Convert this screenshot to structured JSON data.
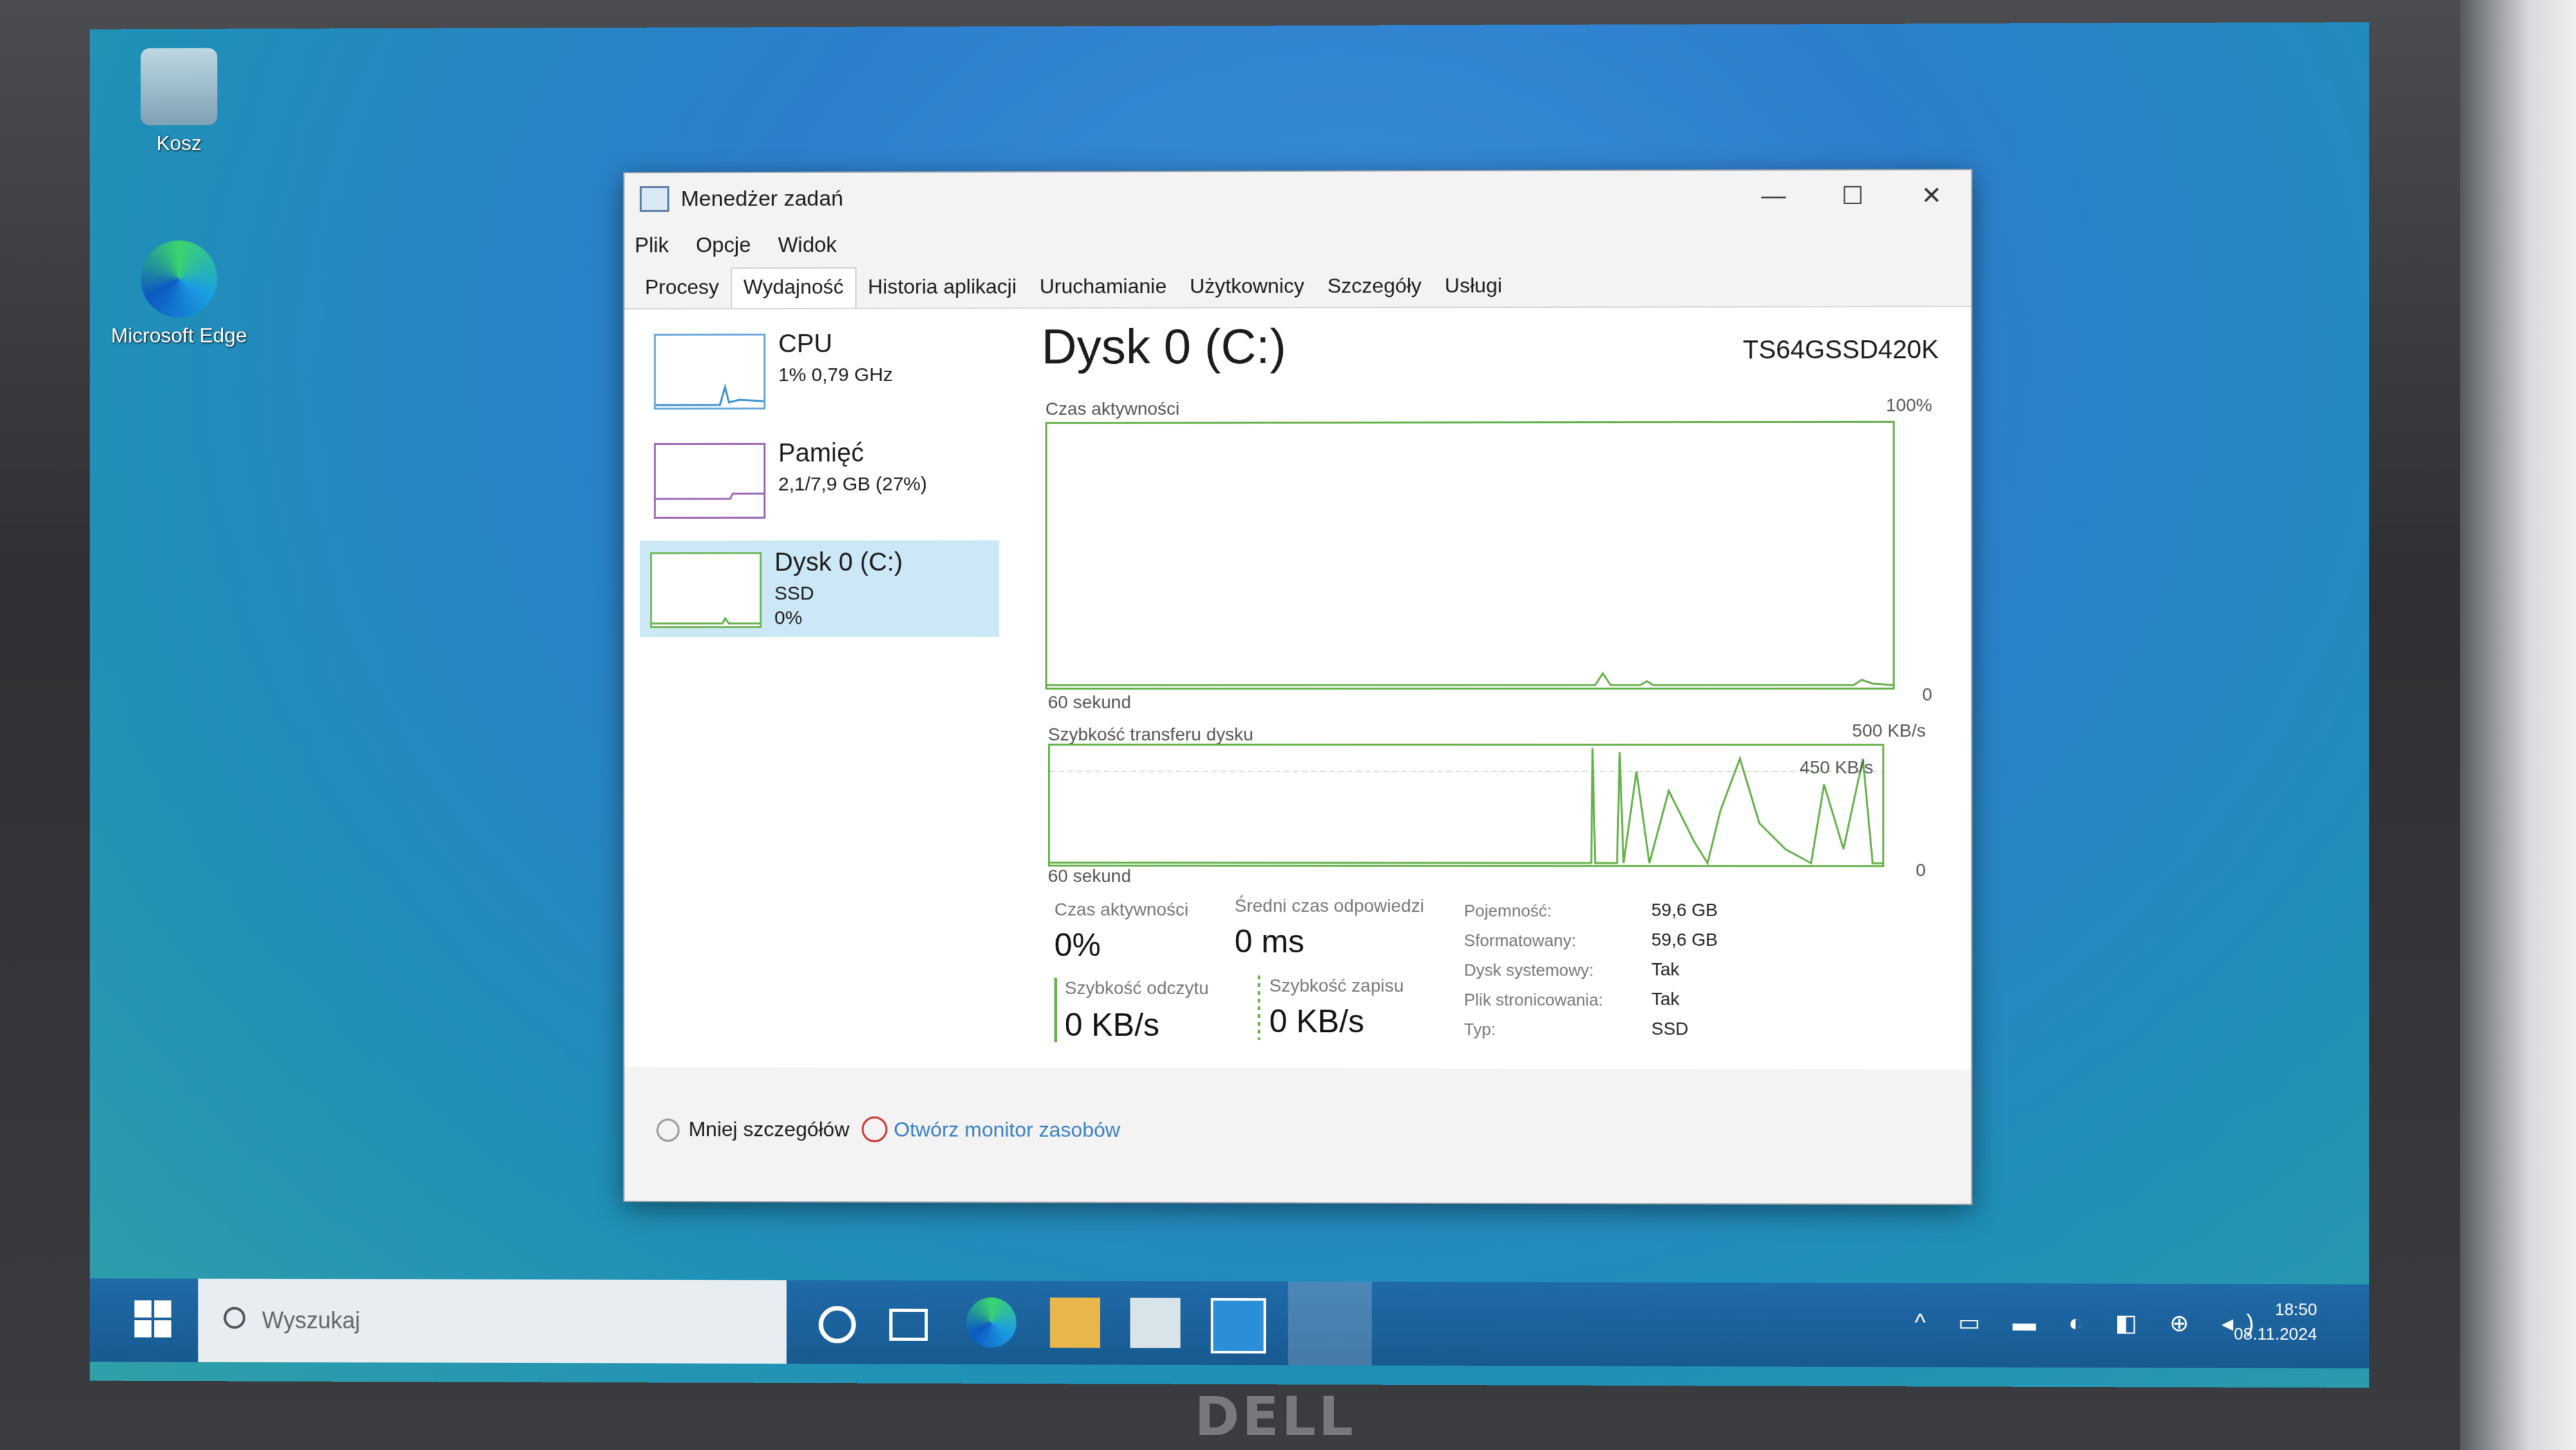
{
  "desktop": {
    "icons": [
      {
        "label": "Kosz"
      },
      {
        "label": "Microsoft Edge"
      }
    ]
  },
  "window": {
    "title": "Menedżer zadań",
    "menu": [
      "Plik",
      "Opcje",
      "Widok"
    ],
    "tabs": [
      "Procesy",
      "Wydajność",
      "Historia aplikacji",
      "Uruchamianie",
      "Użytkownicy",
      "Szczegóły",
      "Usługi"
    ],
    "active_tab": "Wydajność"
  },
  "sidebar": {
    "items": [
      {
        "title": "CPU",
        "sub": "1% 0,79 GHz",
        "sub2": ""
      },
      {
        "title": "Pamięć",
        "sub": "2,1/7,9 GB (27%)",
        "sub2": ""
      },
      {
        "title": "Dysk 0 (C:)",
        "sub": "SSD",
        "sub2": "0%"
      }
    ]
  },
  "disk": {
    "title": "Dysk 0 (C:)",
    "model": "TS64GSSD420K",
    "active_time_label": "Czas aktywności",
    "active_time_max": "100%",
    "sixty_sec": "60 sekund",
    "zero": "0",
    "transfer_label": "Szybkość transferu dysku",
    "transfer_max": "500 KB/s",
    "transfer_mid": "450 KB/s",
    "stats": {
      "active_label": "Czas aktywności",
      "active_val": "0%",
      "resp_label": "Średni czas odpowiedzi",
      "resp_val": "0 ms",
      "read_label": "Szybkość odczytu",
      "read_val": "0 KB/s",
      "write_label": "Szybkość zapisu",
      "write_val": "0 KB/s"
    },
    "props": [
      {
        "key": "Pojemność:",
        "val": "59,6 GB"
      },
      {
        "key": "Sformatowany:",
        "val": "59,6 GB"
      },
      {
        "key": "Dysk systemowy:",
        "val": "Tak"
      },
      {
        "key": "Plik stronicowania:",
        "val": "Tak"
      },
      {
        "key": "Typ:",
        "val": "SSD"
      }
    ]
  },
  "footer": {
    "less": "Mniej szczegółów",
    "monitor": "Otwórz monitor zasobów"
  },
  "taskbar": {
    "search_placeholder": "Wyszukaj",
    "time": "18:50",
    "date": "08.11.2024"
  },
  "bezel": {
    "brand": "DELL"
  }
}
